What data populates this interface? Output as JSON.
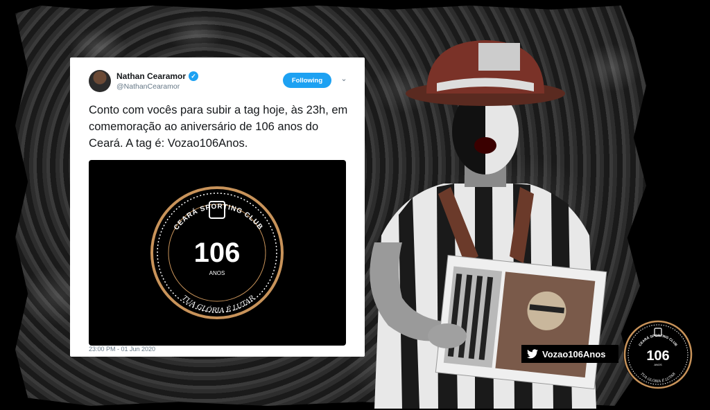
{
  "tweet": {
    "author_name": "Nathan Cearamor",
    "author_handle": "@NathanCearamor",
    "follow_label": "Following",
    "text": "Conto com vocês para subir a tag hoje, às 23h, em comemoração ao aniversário de 106 anos do Ceará. A tag é:  Vozao106Anos.",
    "timestamp": "23:00 PM - 01 Jun 2020"
  },
  "seal": {
    "club": "CEARÁ SPORTING CLUB",
    "number": "106",
    "anos": "ANOS",
    "motto": "TUA GLÓRIA É LUTAR"
  },
  "hashtag": {
    "label": "Vozao106Anos"
  },
  "colors": {
    "twitter_blue": "#1da1f2",
    "gold": "#c8935a"
  },
  "icons": [
    "verified-icon",
    "chevron-down-icon",
    "twitter-bird-icon"
  ]
}
